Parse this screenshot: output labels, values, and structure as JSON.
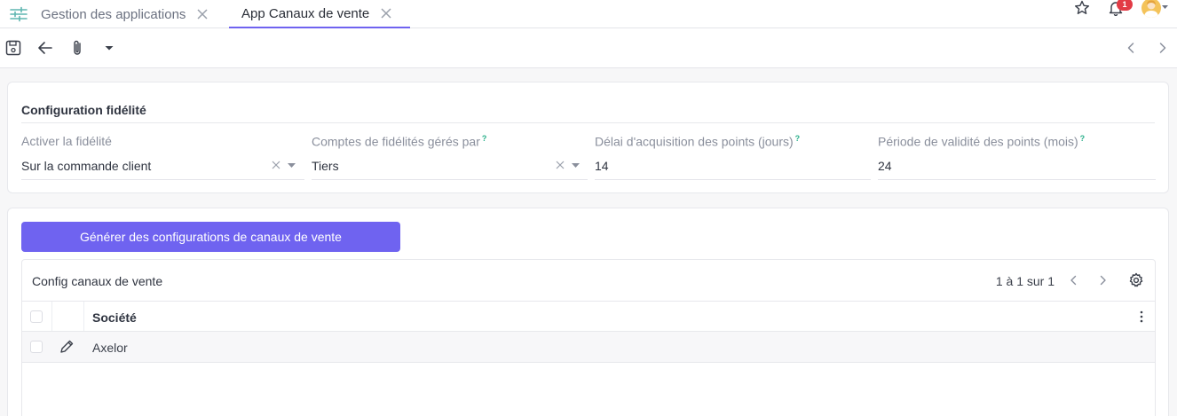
{
  "tabs": [
    {
      "label": "Gestion des applications",
      "icon": "sliders-icon",
      "active": false
    },
    {
      "label": "App Canaux de vente",
      "active": true
    }
  ],
  "header": {
    "notification_count": "1"
  },
  "toolbar": {
    "icons": [
      "save-icon",
      "arrow-left-icon",
      "paperclip-icon",
      "caret-down-icon",
      "chevron-left-icon",
      "chevron-right-icon"
    ]
  },
  "loyalty": {
    "title": "Configuration fidélité",
    "fields": {
      "activate": {
        "label": "Activer la fidélité",
        "value": "Sur la commande client"
      },
      "accounts": {
        "label": "Comptes de fidélités gérés par",
        "help": "?",
        "value": "Tiers"
      },
      "delay": {
        "label": "Délai d'acquisition des points (jours)",
        "help": "?",
        "value": "14"
      },
      "validity": {
        "label": "Période de validité des points (mois)",
        "help": "?",
        "value": "24"
      }
    }
  },
  "channels": {
    "generate_label": "Générer des configurations de canaux de vente",
    "grid_title": "Config canaux de vente",
    "pagination": "1 à 1 sur 1",
    "columns": [
      "Société"
    ],
    "rows": [
      {
        "company": "Axelor"
      }
    ]
  },
  "colors": {
    "accent": "#6f63f0",
    "badge": "#e23b45",
    "help": "#2ab08a"
  }
}
